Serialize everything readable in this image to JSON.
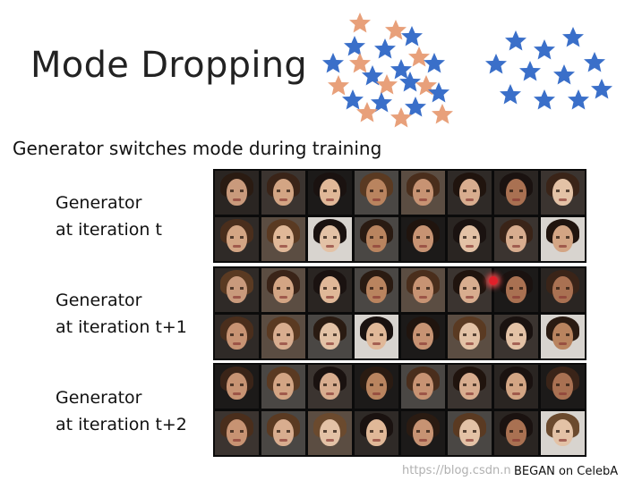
{
  "slide": {
    "title": "Mode Dropping",
    "subtitle": "Generator switches mode during training",
    "credit": "BEGAN on CelebA",
    "watermark": "https://blog.csdn.n"
  },
  "illustration": {
    "star_colors": {
      "real": "#e8a07a",
      "generated": "#3a6fc9"
    }
  },
  "groups": [
    {
      "line1": "Generator",
      "line2": "at iteration t"
    },
    {
      "line1": "Generator",
      "line2": "at iteration t+1"
    },
    {
      "line1": "Generator",
      "line2": "at iteration t+2"
    }
  ]
}
